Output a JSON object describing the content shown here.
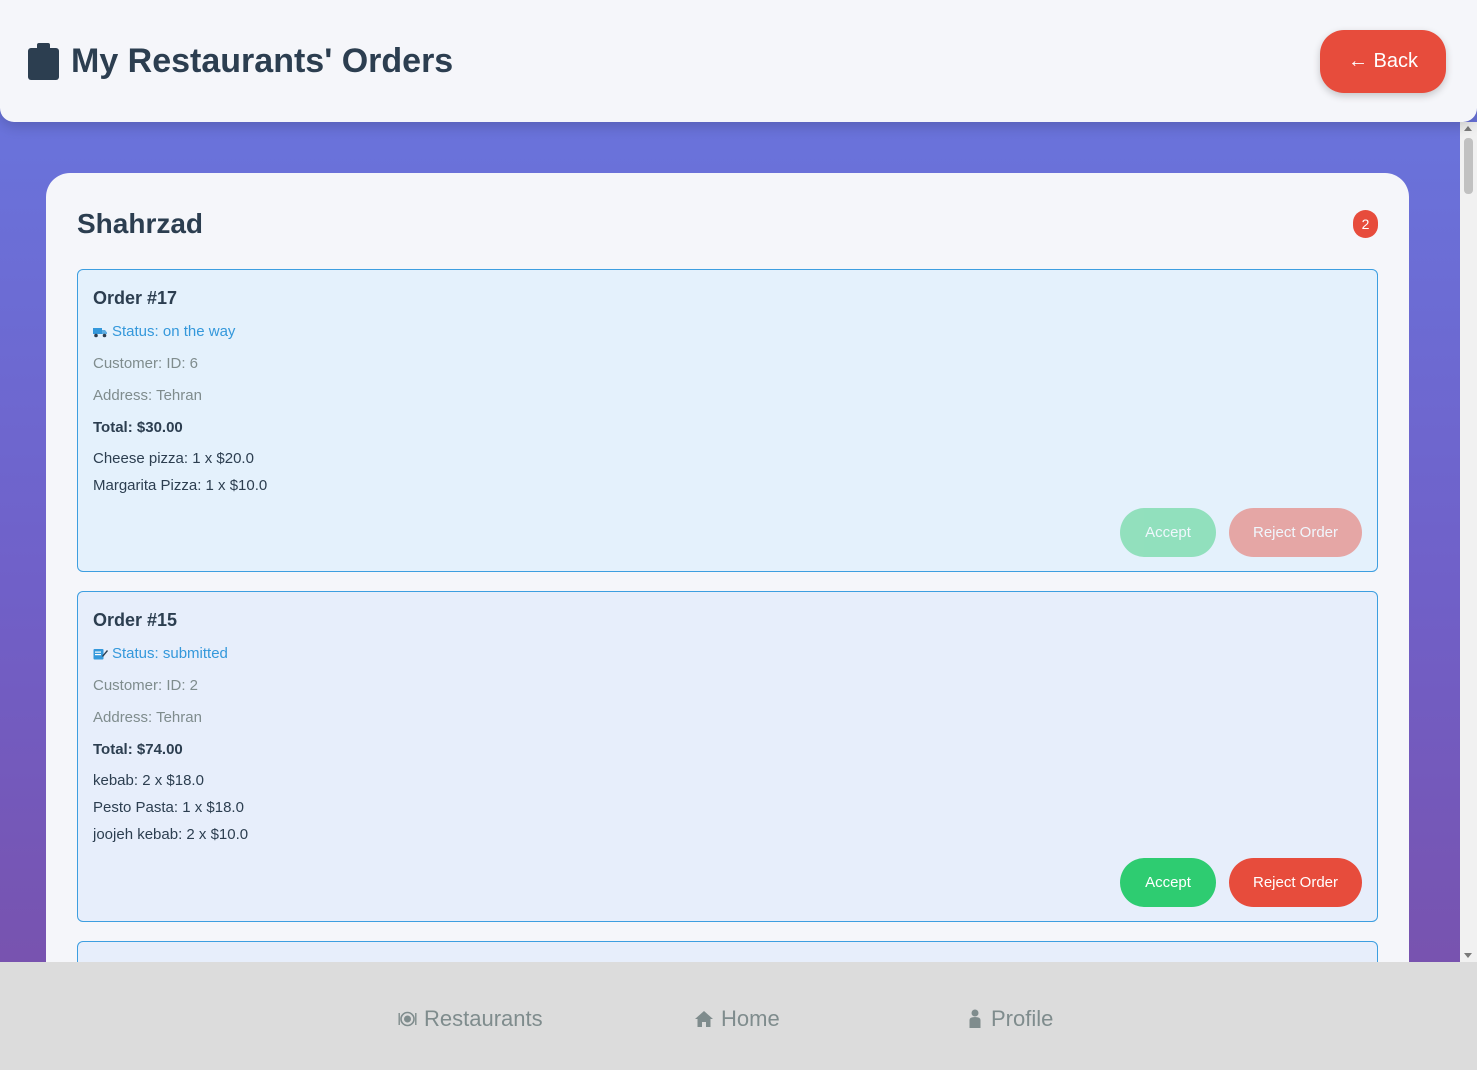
{
  "header": {
    "title": "My Restaurants' Orders",
    "back_label": "← Back"
  },
  "restaurant": {
    "name": "Shahrzad",
    "order_count": "2"
  },
  "orders": [
    {
      "title": "Order #17",
      "status": "Status: on the way",
      "status_icon": "delivery-truck-icon",
      "customer": "Customer: ID: 6",
      "address": "Address: Tehran",
      "total": "Total: $30.00",
      "items": [
        "Cheese pizza: 1 x $20.0",
        "Margarita Pizza: 1 x $10.0"
      ],
      "accept_label": "Accept",
      "reject_label": "Reject Order",
      "actions_enabled": false
    },
    {
      "title": "Order #15",
      "status": "Status: submitted",
      "status_icon": "memo-icon",
      "customer": "Customer: ID: 2",
      "address": "Address: Tehran",
      "total": "Total: $74.00",
      "items": [
        "kebab: 2 x $18.0",
        "Pesto Pasta: 1 x $18.0",
        "joojeh kebab: 2 x $10.0"
      ],
      "accept_label": "Accept",
      "reject_label": "Reject Order",
      "actions_enabled": true
    }
  ],
  "nav": {
    "restaurants_label": "Restaurants",
    "home_label": "Home",
    "profile_label": "Profile"
  },
  "colors": {
    "accent_red": "#e74c3c",
    "accent_green": "#2ecc71",
    "status_blue": "#3498db",
    "title_dark": "#2c3e50"
  }
}
